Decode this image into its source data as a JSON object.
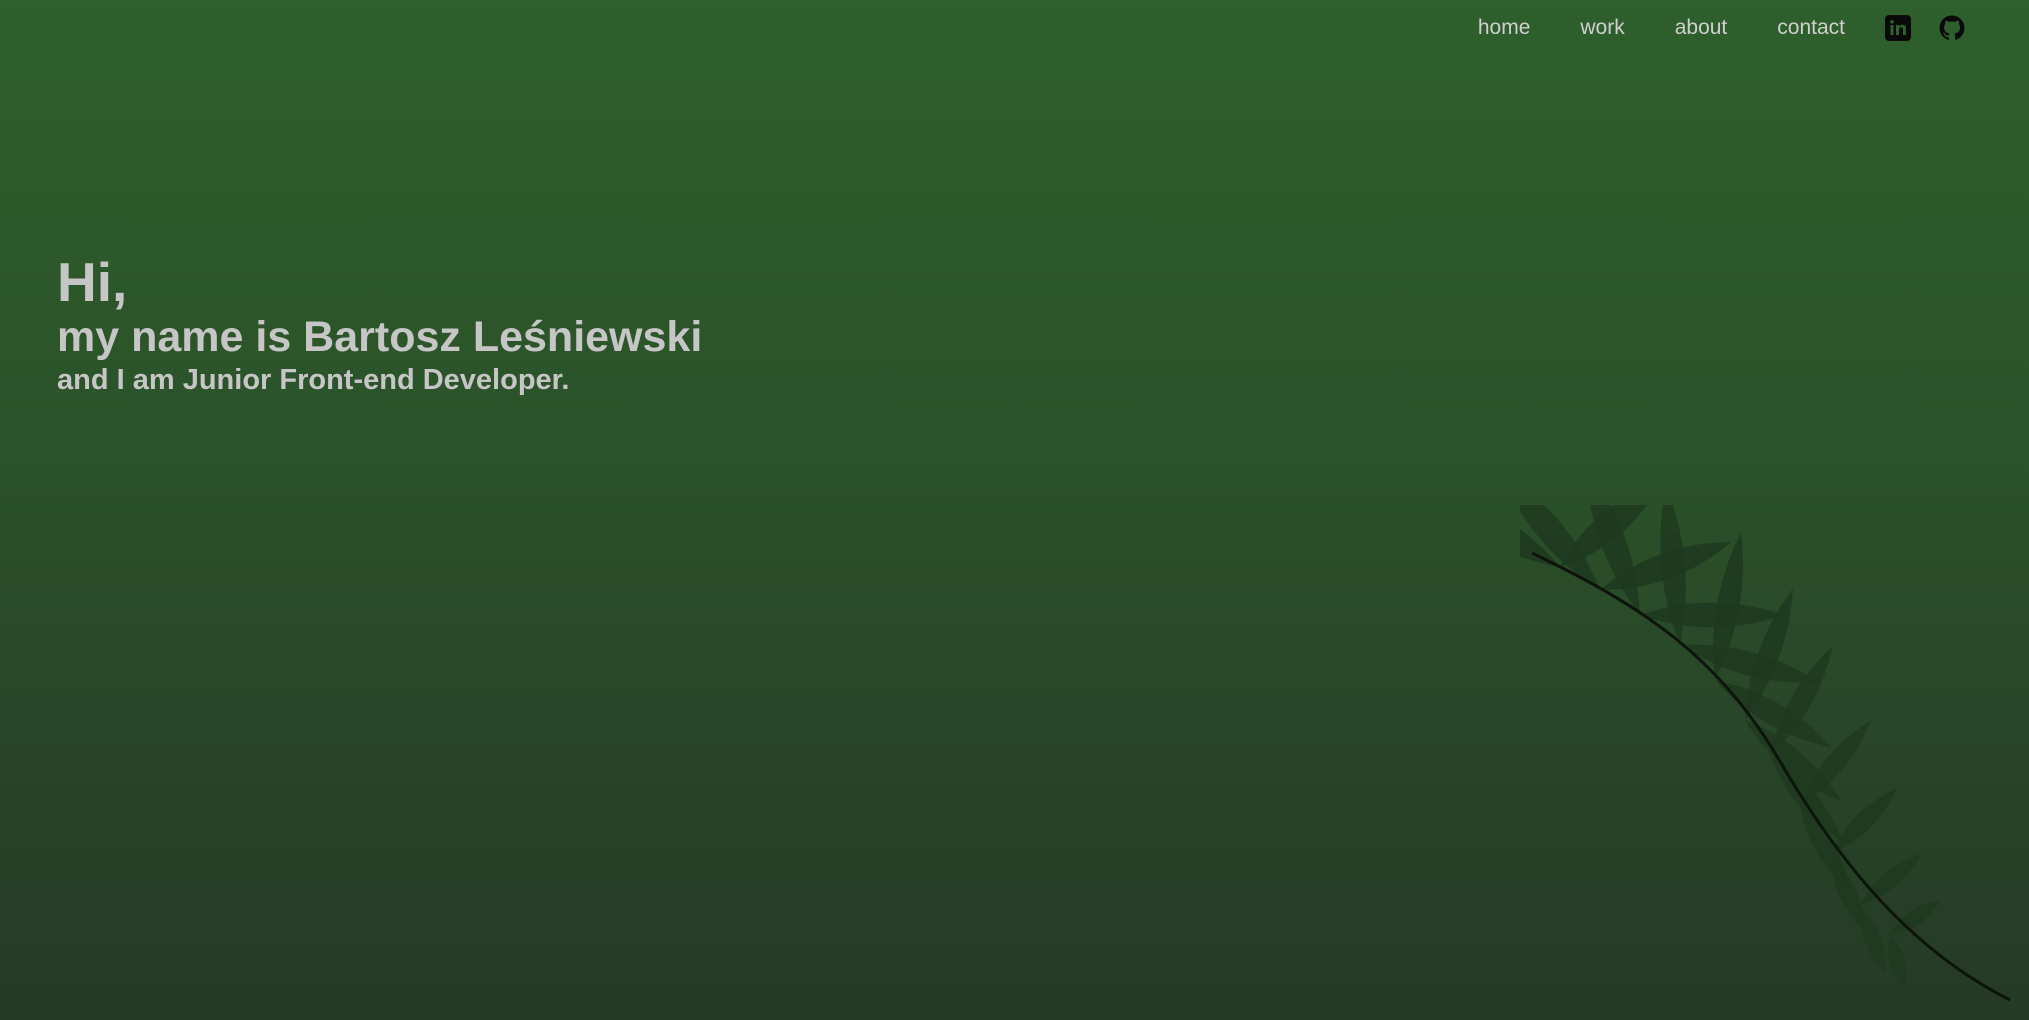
{
  "nav": {
    "links": [
      {
        "label": "home"
      },
      {
        "label": "work"
      },
      {
        "label": "about"
      },
      {
        "label": "contact"
      }
    ],
    "social": [
      {
        "icon": "linkedin-icon"
      },
      {
        "icon": "github-icon"
      }
    ]
  },
  "hero": {
    "greeting": "Hi,",
    "name_line": "my name is Bartosz Leśniewski",
    "role_line": "and I am Junior Front-end Developer."
  },
  "colors": {
    "background_top": "#2f5f2d",
    "background_bottom": "#253a25",
    "text": "#c6c6c6",
    "fern": "#1e3a1e"
  }
}
